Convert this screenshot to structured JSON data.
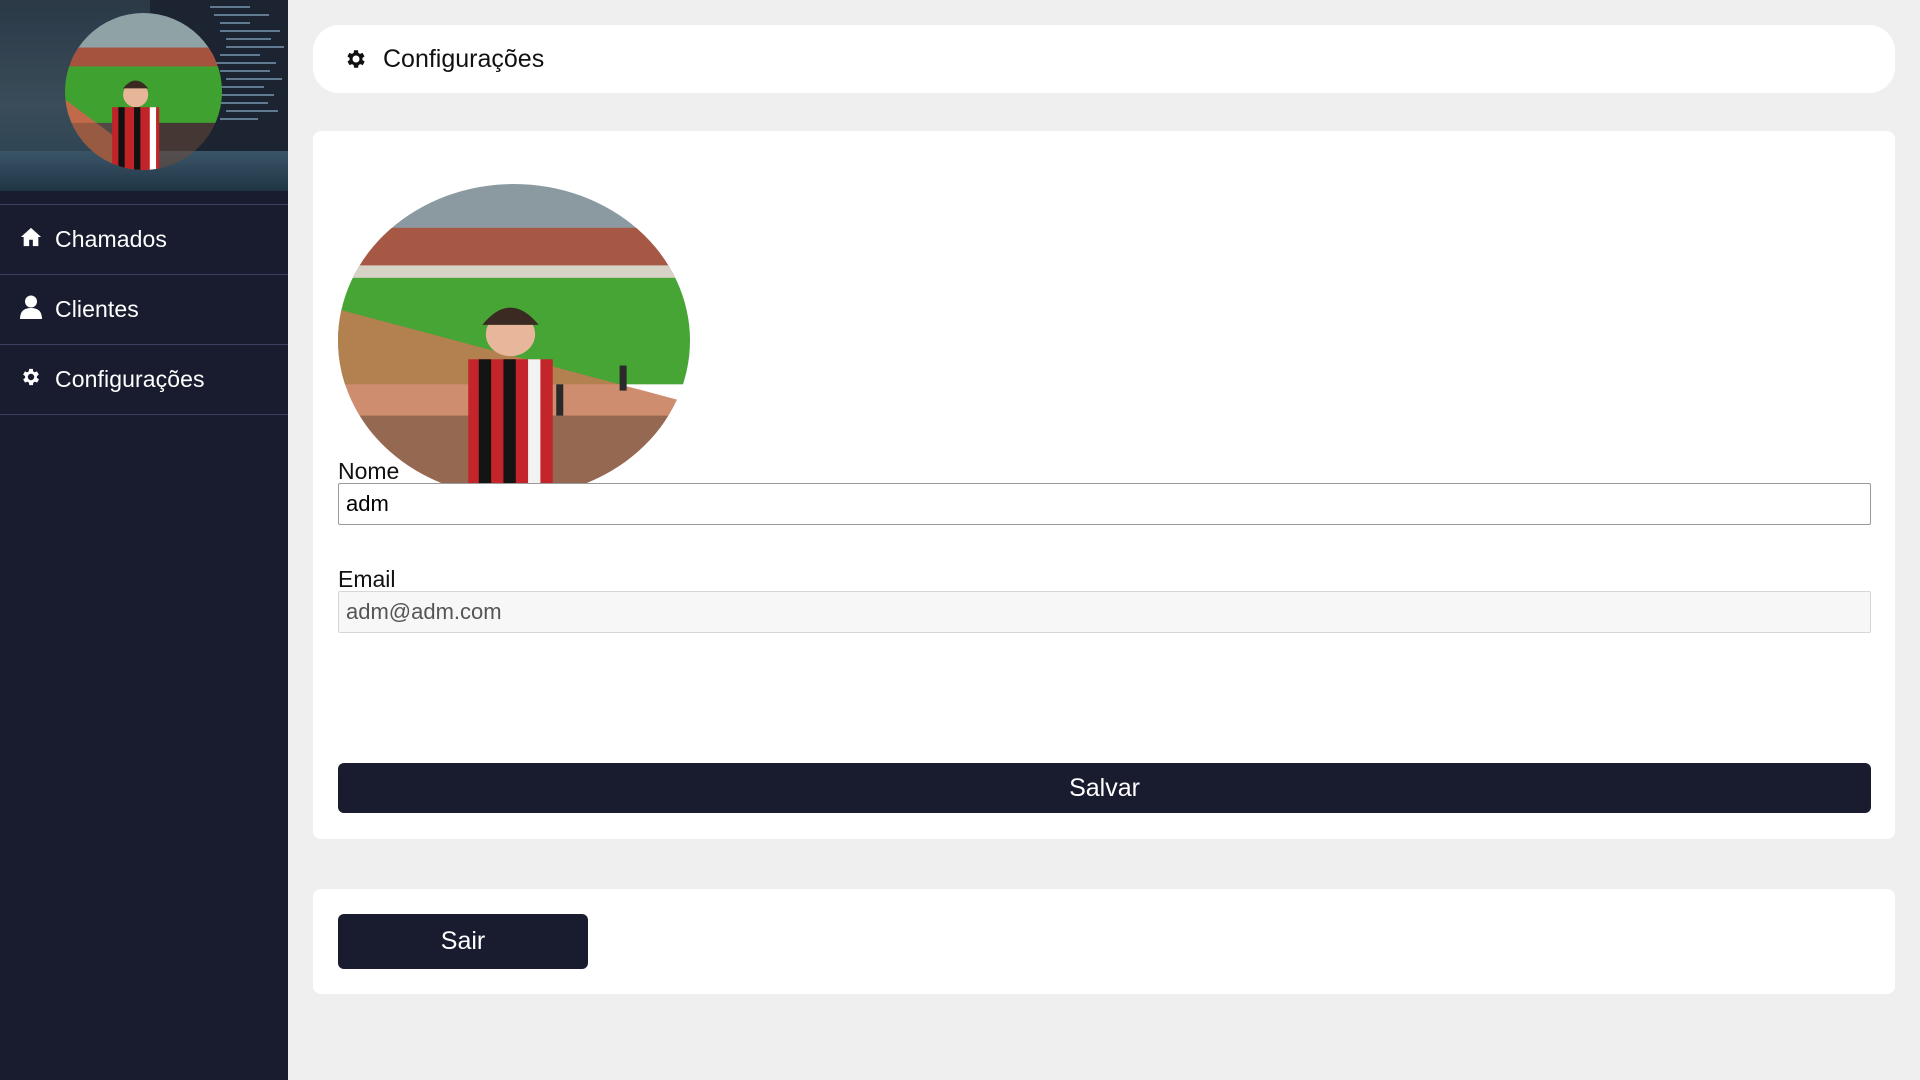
{
  "sidebar": {
    "items": [
      {
        "label": "Chamados",
        "icon": "home-icon"
      },
      {
        "label": "Clientes",
        "icon": "user-icon"
      },
      {
        "label": "Configurações",
        "icon": "gear-icon"
      }
    ]
  },
  "header": {
    "title": "Configurações",
    "icon": "gear-icon"
  },
  "profile": {
    "name_label": "Nome",
    "name_value": "adm",
    "email_label": "Email",
    "email_value": "adm@adm.com",
    "save_label": "Salvar"
  },
  "logout": {
    "label": "Sair"
  },
  "colors": {
    "sidebar_bg": "#181c2e",
    "page_bg": "#efefef",
    "button_bg": "#181c2e",
    "card_bg": "#ffffff"
  }
}
